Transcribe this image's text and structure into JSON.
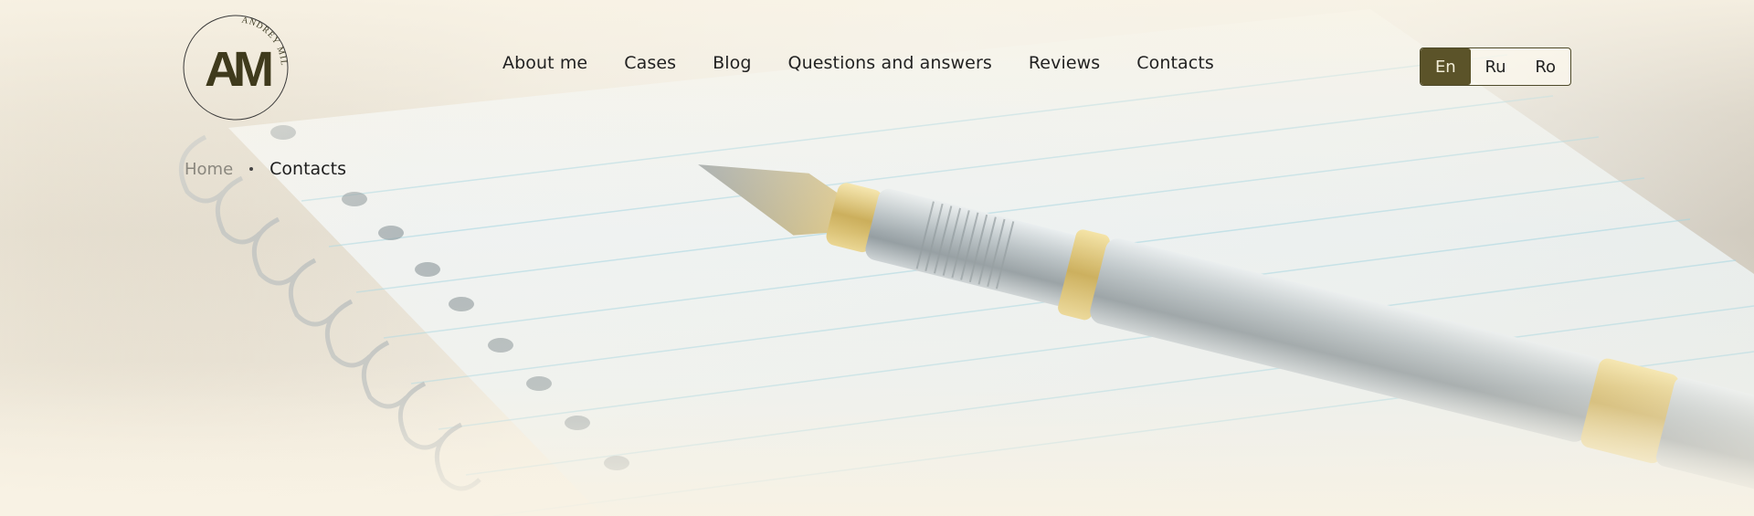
{
  "logo": {
    "monogram": "AM",
    "arc_text": "ANDREY MILOSTA",
    "icon": "logo-monogram"
  },
  "nav": {
    "items": [
      {
        "label": "About me"
      },
      {
        "label": "Cases"
      },
      {
        "label": "Blog"
      },
      {
        "label": "Questions and answers"
      },
      {
        "label": "Reviews"
      },
      {
        "label": "Contacts"
      }
    ]
  },
  "language": {
    "options": [
      "En",
      "Ru",
      "Ro"
    ],
    "selected": "En"
  },
  "breadcrumb": {
    "home": "Home",
    "current": "Contacts"
  },
  "colors": {
    "accent": "#5b5329",
    "text": "#222222",
    "muted": "#8a877e",
    "background": "#f6f0e2"
  },
  "hero": {
    "image": "fountain-pen-on-spiral-notebook"
  }
}
